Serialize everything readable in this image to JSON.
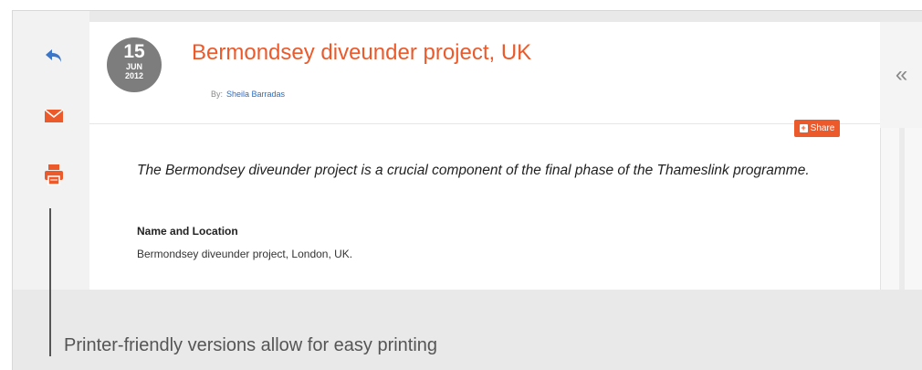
{
  "toolbar": {
    "icons": [
      "reply-icon",
      "envelope-icon",
      "printer-icon"
    ]
  },
  "article": {
    "date": {
      "day": "15",
      "month": "JUN",
      "year": "2012"
    },
    "title": "Bermondsey diveunder project, UK",
    "byline_prefix": "By:",
    "author": "Sheila Barradas",
    "share_label": "Share",
    "lead": "The Bermondsey diveunder project is a crucial component of the final phase of the Thameslink programme.",
    "section_heading": "Name and Location",
    "section_body": "Bermondsey diveunder project, London, UK."
  },
  "collapse_label": "«",
  "callout": "Printer-friendly versions allow for easy printing",
  "colors": {
    "accent": "#ec5a2b",
    "link": "#2b6cc4",
    "badge": "#7d7d7d",
    "reply": "#3a76c9"
  }
}
